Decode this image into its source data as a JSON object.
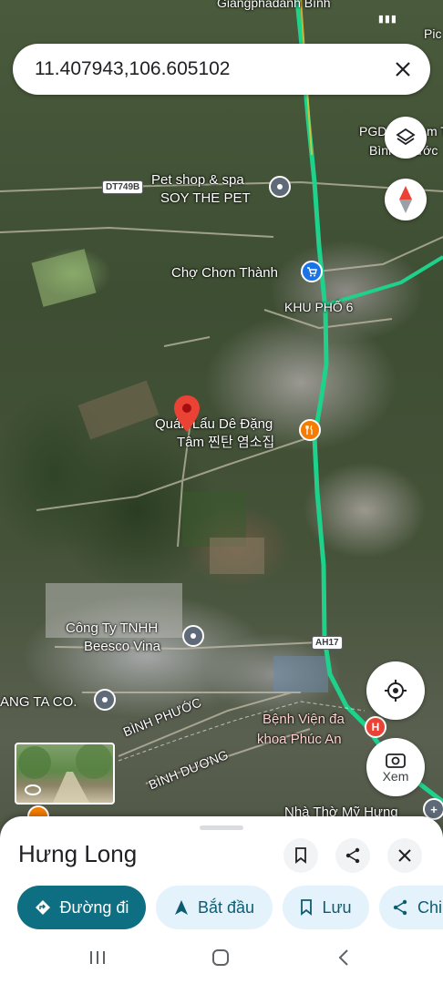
{
  "search": {
    "query": "11.407943,106.605102"
  },
  "map_labels": {
    "top_partial": "Giángpháđánh Bình",
    "pgd": "PGD",
    "pgd_line2": "Bình Phước",
    "pgd_right": "m T",
    "pic_partial": "Pic",
    "pet_shop_1": "Pet shop & spa",
    "pet_shop_2": "SOY THE PET",
    "road_dt749b": "DT749B",
    "cho_chon_thanh": "Chợ Chơn Thành",
    "khu_pho_6": "KHU PHỐ 6",
    "quan_lau_1": "Quán Lẩu Dê Đặng",
    "quan_lau_2": "Tâm 찐탄 염소집",
    "cong_ty_1": "Công Ty TNHH",
    "cong_ty_2": "Beesco Vina",
    "ang_ta": "ANG TA CO.",
    "road_ah17": "AH17",
    "binh_phuoc": "BÌNH PHƯỚC",
    "binh_duong": "BÌNH DƯƠNG",
    "benh_vien_1": "Bệnh Viện đa",
    "benh_vien_2": "khoa Phúc An",
    "nha_tho": "Nhà Thờ Mỹ Hưng"
  },
  "controls": {
    "lens_label": "Xem"
  },
  "place": {
    "name": "Hưng Long",
    "actions": [
      {
        "label": "Đường đi",
        "icon": "directions-icon"
      },
      {
        "label": "Bắt đầu",
        "icon": "navigation-arrow-icon"
      },
      {
        "label": "Lưu",
        "icon": "bookmark-icon"
      },
      {
        "label": "Chi",
        "icon": "share-icon"
      }
    ]
  },
  "colors": {
    "route": "#1ed28c",
    "pin": "#ea4335",
    "primary_chip": "#0e6e82",
    "chip_bg": "#e3f2fb"
  }
}
